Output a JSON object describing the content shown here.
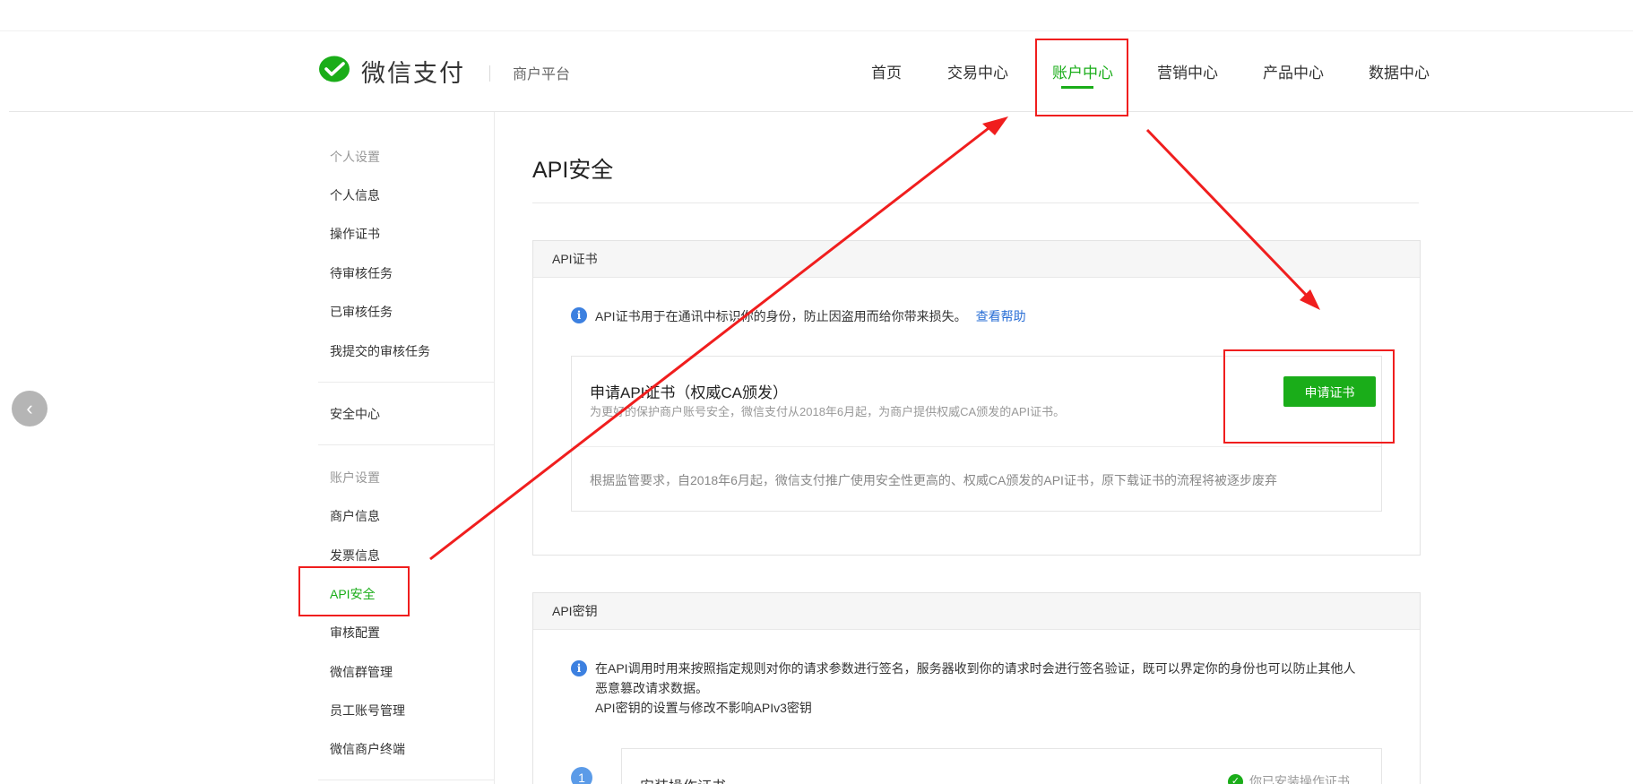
{
  "header": {
    "logo_text": "微信支付",
    "logo_sub": "商户平台",
    "nav": [
      {
        "label": "首页",
        "active": false
      },
      {
        "label": "交易中心",
        "active": false
      },
      {
        "label": "账户中心",
        "active": true
      },
      {
        "label": "营销中心",
        "active": false
      },
      {
        "label": "产品中心",
        "active": false
      },
      {
        "label": "数据中心",
        "active": false
      }
    ]
  },
  "sidebar": {
    "items": [
      {
        "label": "个人设置",
        "type": "group"
      },
      {
        "label": "个人信息",
        "type": "item"
      },
      {
        "label": "操作证书",
        "type": "item"
      },
      {
        "label": "待审核任务",
        "type": "item"
      },
      {
        "label": "已审核任务",
        "type": "item"
      },
      {
        "label": "我提交的审核任务",
        "type": "item"
      },
      {
        "label": "安全中心",
        "type": "item"
      },
      {
        "label": "账户设置",
        "type": "group"
      },
      {
        "label": "商户信息",
        "type": "item"
      },
      {
        "label": "发票信息",
        "type": "item"
      },
      {
        "label": "API安全",
        "type": "item",
        "active": true
      },
      {
        "label": "审核配置",
        "type": "item"
      },
      {
        "label": "微信群管理",
        "type": "item"
      },
      {
        "label": "员工账号管理",
        "type": "item"
      },
      {
        "label": "微信商户终端",
        "type": "item"
      }
    ]
  },
  "main": {
    "title": "API安全",
    "cert_panel": {
      "header": "API证书",
      "info": "API证书用于在通讯中标识你的身份，防止因盗用而给你带来损失。",
      "help_link": "查看帮助",
      "apply_title": "申请API证书（权威CA颁发）",
      "apply_desc": "为更好的保护商户账号安全，微信支付从2018年6月起，为商户提供权威CA颁发的API证书。",
      "apply_button": "申请证书",
      "note": "根据监管要求，自2018年6月起，微信支付推广使用安全性更高的、权威CA颁发的API证书，原下载证书的流程将被逐步废弃"
    },
    "key_panel": {
      "header": "API密钥",
      "info_line1": "在API调用时用来按照指定规则对你的请求参数进行签名，服务器收到你的请求时会进行签名验证，既可以界定你的身份也可以防止其他人",
      "info_line2": "恶意篡改请求数据。",
      "info_line3": "API密钥的设置与修改不影响APIv3密钥",
      "step_number": "1",
      "step_title": "安装操作证书",
      "step_status": "你已安装操作证书"
    }
  },
  "icons": {
    "logo": "wechat-pay-logo-icon",
    "prev": "chevron-left-icon",
    "info": "info-icon",
    "check": "check-circle-icon"
  },
  "colors": {
    "accent": "#1aad19",
    "link": "#2a6fd6",
    "annotation": "#f01e1e"
  }
}
